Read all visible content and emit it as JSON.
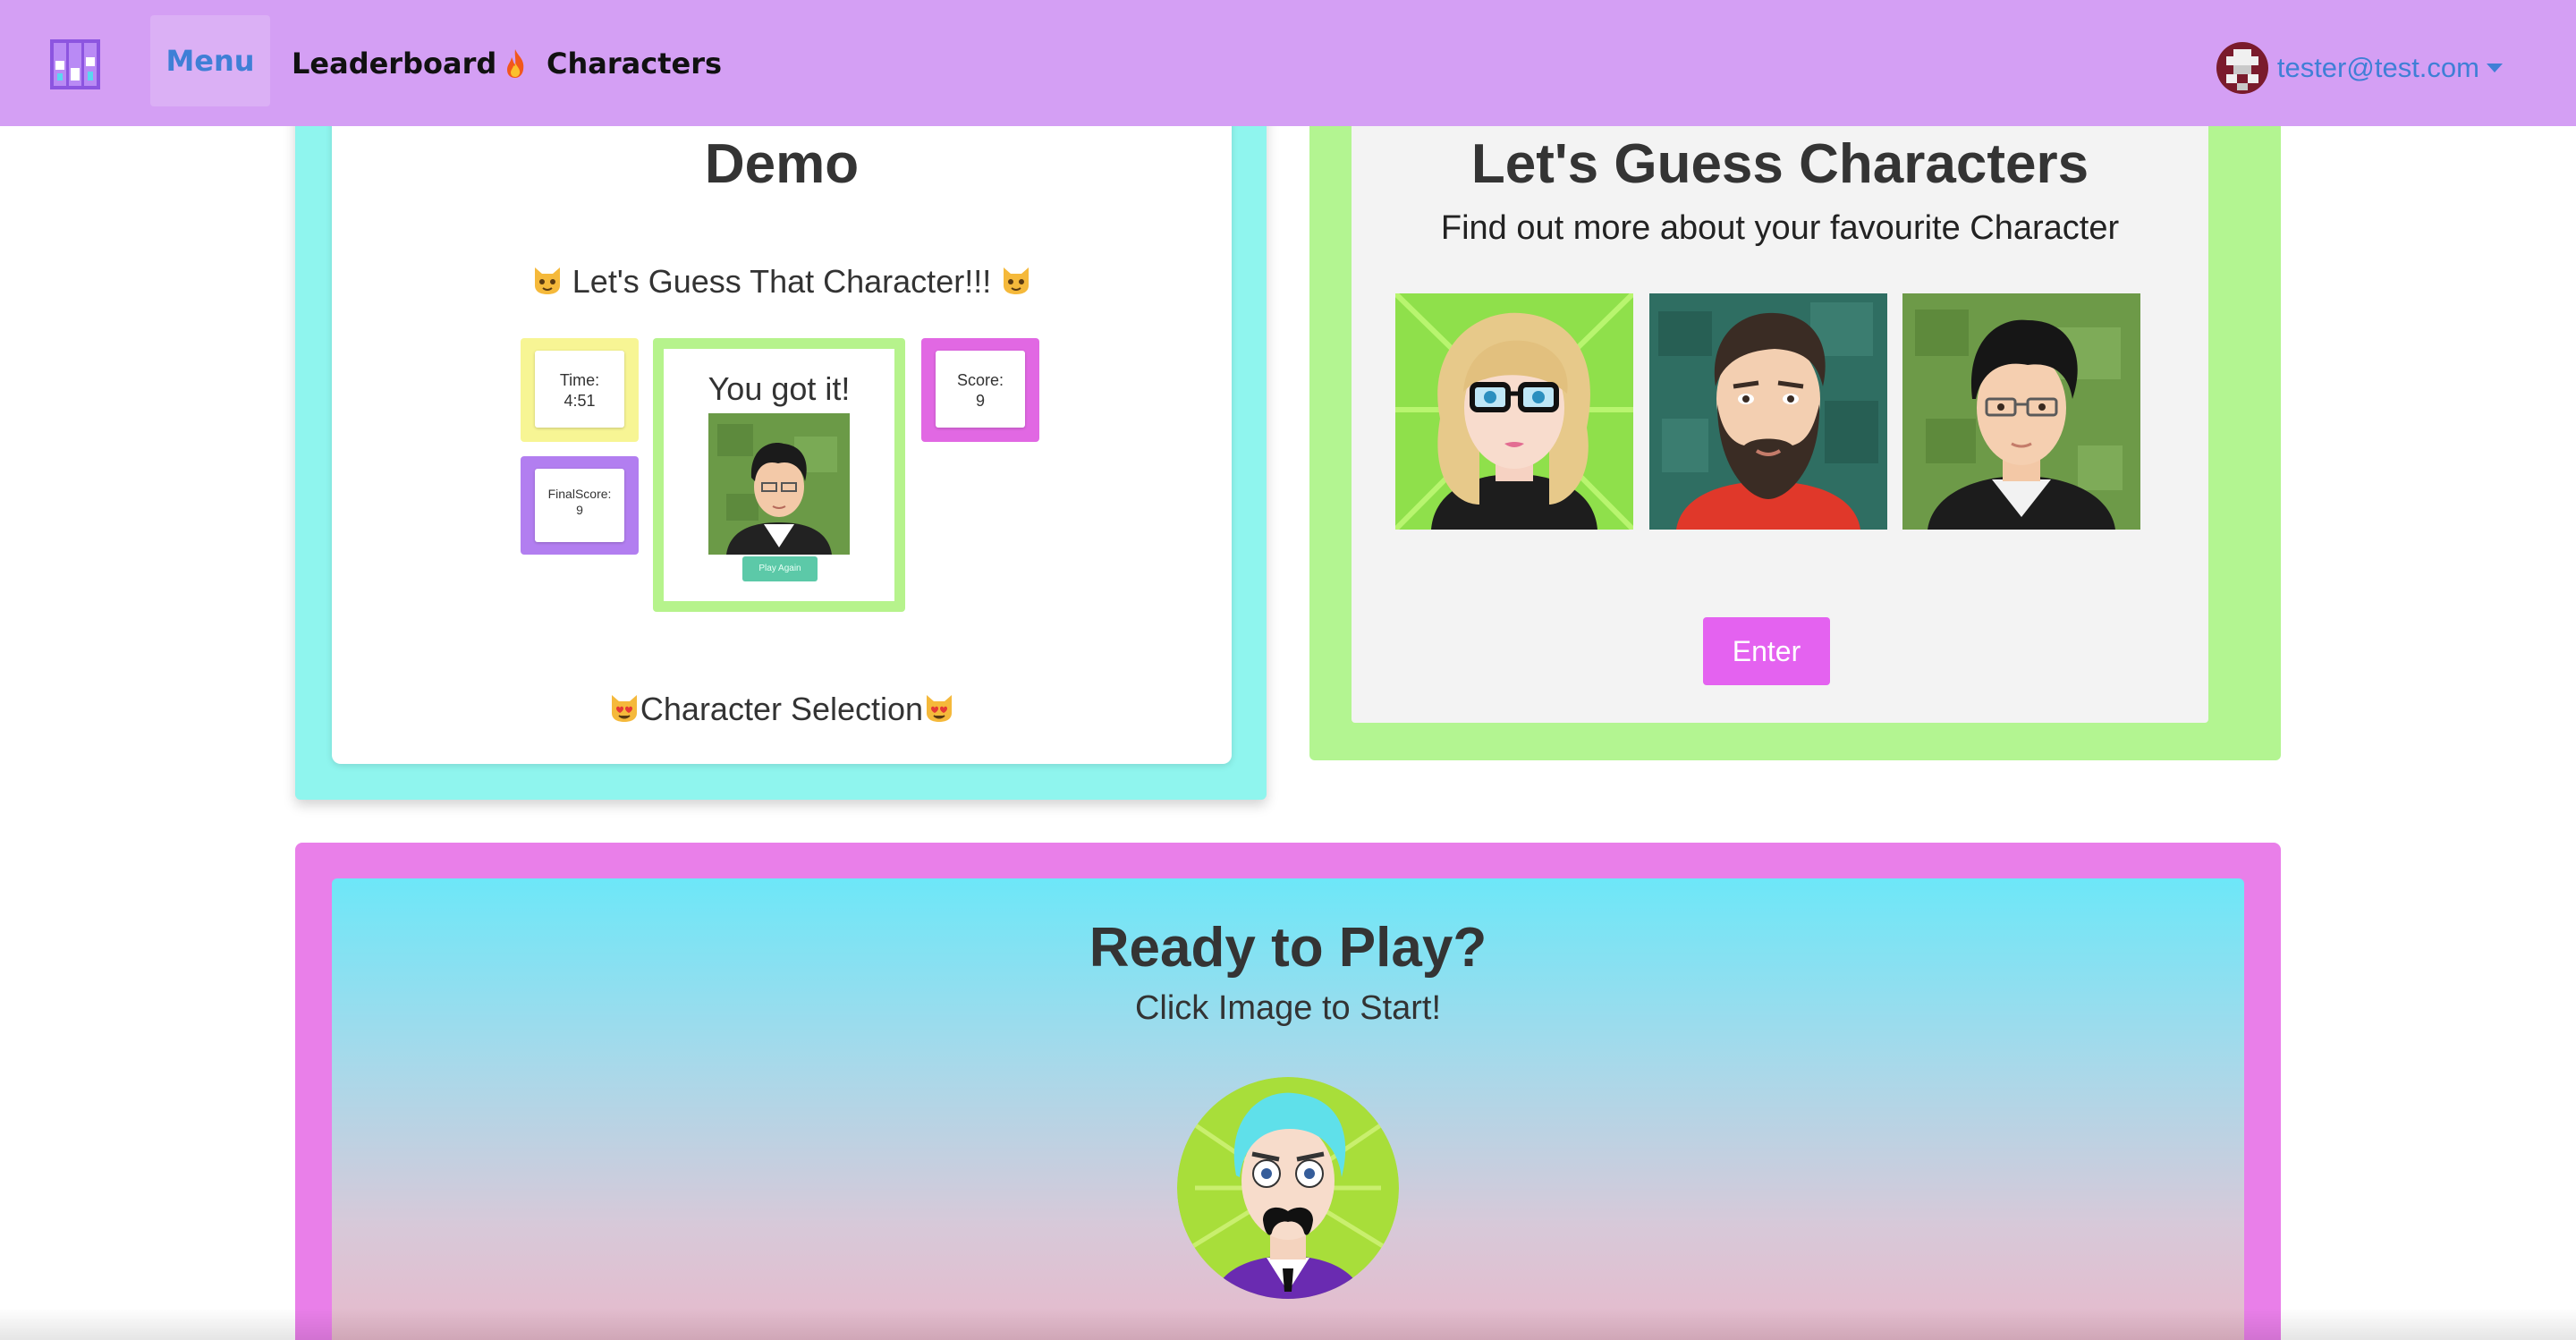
{
  "navbar": {
    "brand_icon": "pixel-grid-logo-icon",
    "menu_label": "Menu",
    "leaderboard_label": "Leaderboard",
    "leaderboard_icon": "fire-icon",
    "characters_label": "Characters",
    "user_email": "tester@test.com",
    "user_avatar_icon": "pixel-avatar-icon",
    "caret_icon": "caret-down-icon"
  },
  "demo": {
    "title": "Demo",
    "subtitle": "Let's Guess That Character!!!",
    "subtitle_icon": "cat-face-icon",
    "time_label": "Time:",
    "time_value": "4:51",
    "score_label": "Score:",
    "score_value": "9",
    "final_label": "FinalScore:",
    "final_value": "9",
    "got_it": "You got it!",
    "play_again": "Play Again",
    "selection_label": "Character Selection",
    "selection_icon": "heart-eyes-cat-icon"
  },
  "guess": {
    "title": "Let's Guess Characters",
    "subtitle": "Find out more about your favourite Character",
    "avatars": [
      "blonde-glasses-avatar",
      "bearded-man-avatar",
      "dark-hair-glasses-avatar"
    ],
    "enter_label": "Enter"
  },
  "ready": {
    "title": "Ready to Play?",
    "subtitle": "Click Image to Start!",
    "start_avatar": "mustache-man-avatar"
  },
  "colors": {
    "navbar": "#d49ff4",
    "link": "#3f7fd6",
    "demo_border": "#8ff5ee",
    "guess_border": "#b3f591",
    "ready_border": "#e97fe9",
    "enter_button": "#e462f0"
  }
}
